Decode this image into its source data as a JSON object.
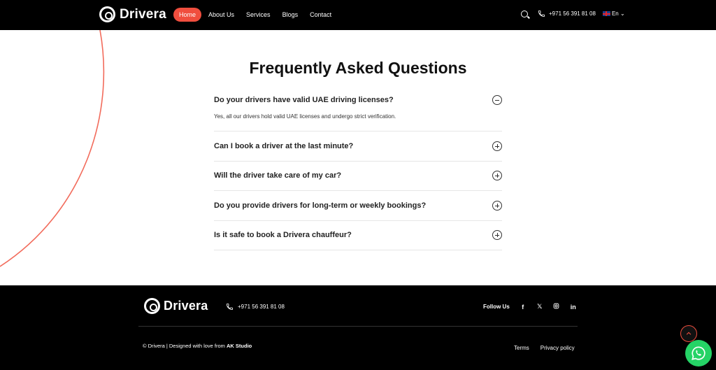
{
  "header": {
    "brand": "Drivera",
    "nav": [
      {
        "label": "Home",
        "active": true
      },
      {
        "label": "About Us",
        "active": false
      },
      {
        "label": "Services",
        "active": false
      },
      {
        "label": "Blogs",
        "active": false
      },
      {
        "label": "Contact",
        "active": false
      }
    ],
    "phone": "+971 56 391 81 08",
    "language": "En"
  },
  "faq": {
    "title": "Frequently Asked Questions",
    "items": [
      {
        "question": "Do your drivers have valid UAE driving licenses?",
        "answer": "Yes, all our drivers hold valid UAE licenses and undergo strict verification.",
        "open": true
      },
      {
        "question": "Can I book a driver at the last minute?",
        "open": false
      },
      {
        "question": "Will the driver take care of my car?",
        "open": false
      },
      {
        "question": "Do you provide drivers for long-term or weekly bookings?",
        "open": false
      },
      {
        "question": "Is it safe to book a Drivera chauffeur?",
        "open": false
      }
    ]
  },
  "footer": {
    "brand": "Drivera",
    "phone": "+971 56 391 81 08",
    "follow_label": "Follow Us",
    "socials": [
      "facebook-icon",
      "x-icon",
      "instagram-icon",
      "linkedin-icon"
    ],
    "copyright_prefix": "© Drivera | Designed with love from ",
    "copyright_studio": "AK Studio",
    "links": {
      "terms": "Terms",
      "privacy": "Privacy policy"
    }
  },
  "colors": {
    "accent": "#f04e3e",
    "whatsapp": "#25d366",
    "dark": "#000000"
  }
}
